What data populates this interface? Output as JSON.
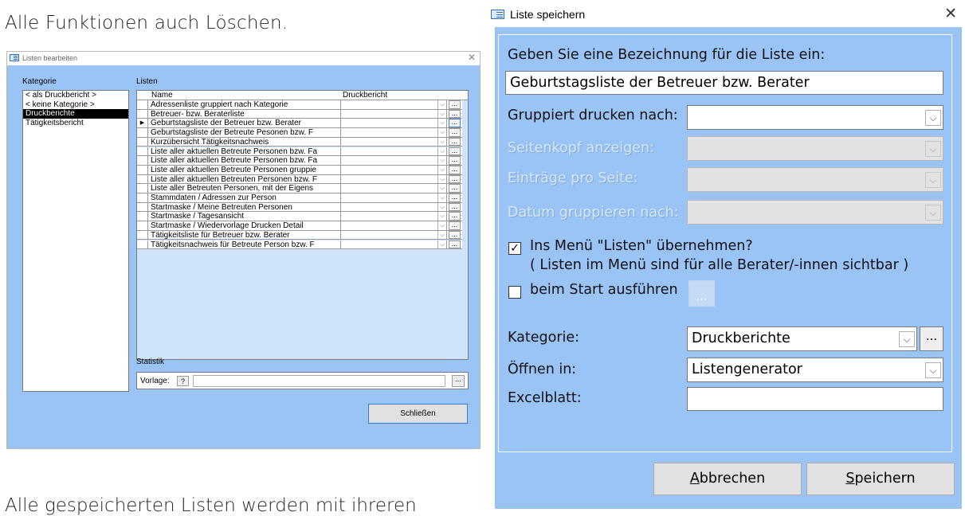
{
  "captions": {
    "top": "Alle Funktionen auch Löschen.",
    "bottom": "Alle gespeicherten Listen werden mit ihreren"
  },
  "left_window": {
    "title": "Listen bearbeiten",
    "kategorie_label": "Kategorie",
    "listen_label": "Listen",
    "kategorien": [
      "< als Druckbericht >",
      "< keine Kategorie >",
      "Druckberichte",
      "Tätigkeitsbericht"
    ],
    "selected_kategorie": 2,
    "grid_headers": {
      "name": "Name",
      "druckbericht": "Druckbericht"
    },
    "rows": [
      "Adressenliste gruppiert nach Kategorie",
      "Betreuer- bzw. Beraterliste",
      "Geburtstagsliste der Betreuer bzw. Berater",
      "Geburtstagsliste der Betreute Pesonen bzw. F",
      "Kurzübersicht Tätigkeitsnachweis",
      "Liste aller aktuellen Betreute Personen bzw. Fa",
      "Liste aller aktuellen Betreute Personen bzw. Fa",
      "Liste aller aktuellen Betreute Personen gruppie",
      "Liste aller aktuellen Betreuten Personen bzw. F",
      "Liste aller Betreuten Personen, mit der Eigens",
      "Stammdaten / Adressen zur Person",
      "Startmaske / Meine Betreuten Personen",
      "Startmaske / Tagesansicht",
      "Startmaske / Wiedervorlage Drucken Detail",
      "Tätigkeitsliste für Betreuer bzw. Berater",
      "Tätigkeitsnachweis für Betreute Person bzw. F"
    ],
    "current_row": 2,
    "statistik_label": "Statistik",
    "vorlage_label": "Vorlage:",
    "vorlage_help": "?",
    "ellipsis": "...",
    "close_button": "Schließen"
  },
  "right_window": {
    "title": "Liste speichern",
    "prompt": "Geben Sie eine Bezeichnung für die Liste ein:",
    "name_value": "Geburtstagsliste der Betreuer bzw. Berater",
    "gruppiert_label": "Gruppiert drucken nach:",
    "gruppiert_value": "",
    "seitenkopf_label": "Seitenkopf anzeigen:",
    "eintraege_label": "Einträge pro Seite:",
    "datum_label": "Datum gruppieren nach:",
    "menu_checkbox_checked": true,
    "menu_checkbox_label": "Ins Menü \"Listen\" übernehmen?",
    "menu_note": "( Listen im Menü sind für alle Berater/-innen sichtbar )",
    "start_checkbox_checked": false,
    "start_checkbox_label": "beim Start ausführen",
    "ellipsis": "...",
    "kategorie_label": "Kategorie:",
    "kategorie_value": "Druckberichte",
    "oeffnen_label": "Öffnen in:",
    "oeffnen_value": "Listengenerator",
    "excel_label": "Excelblatt:",
    "excel_value": "",
    "abbrechen_key": "A",
    "abbrechen_rest": "bbrechen",
    "speichern_key": "S",
    "speichern_rest": "peichern"
  }
}
